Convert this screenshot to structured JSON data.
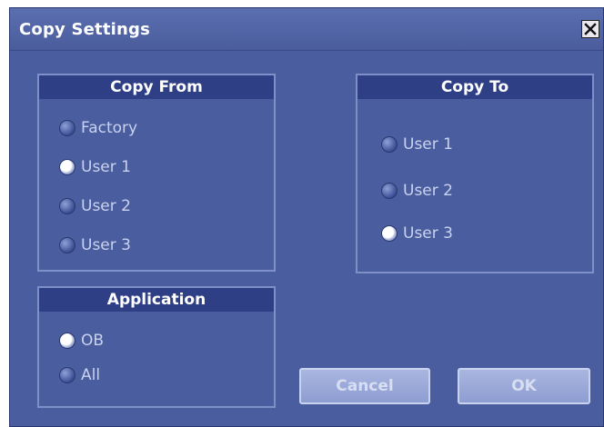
{
  "window": {
    "title": "Copy Settings",
    "close_icon": "close-icon"
  },
  "copy_from": {
    "header": "Copy From",
    "options": [
      {
        "label": "Factory",
        "selected": false
      },
      {
        "label": "User 1",
        "selected": true
      },
      {
        "label": "User 2",
        "selected": false
      },
      {
        "label": "User 3",
        "selected": false
      }
    ]
  },
  "copy_to": {
    "header": "Copy To",
    "options": [
      {
        "label": "User 1",
        "selected": false
      },
      {
        "label": "User 2",
        "selected": false
      },
      {
        "label": "User 3",
        "selected": true
      }
    ]
  },
  "application": {
    "header": "Application",
    "options": [
      {
        "label": "OB",
        "selected": true
      },
      {
        "label": "All",
        "selected": false
      }
    ]
  },
  "buttons": {
    "cancel": "Cancel",
    "ok": "OK"
  },
  "colors": {
    "dialog_bg": "#4a5d9e",
    "header_bg": "#2f3f85",
    "group_border": "#7f90c8",
    "button_bg": "#9aa8da"
  }
}
